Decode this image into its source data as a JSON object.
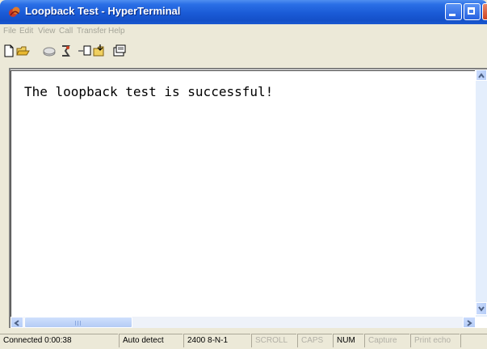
{
  "window": {
    "title": "Loopback Test - HyperTerminal"
  },
  "menu": [
    {
      "label": "File"
    },
    {
      "label": "Edit"
    },
    {
      "label": "View"
    },
    {
      "label": "Call"
    },
    {
      "label": "Transfer"
    },
    {
      "label": "Help"
    }
  ],
  "toolbar": {
    "icons": [
      "new-icon",
      "open-icon",
      "connect-icon",
      "disconnect-icon",
      "send-icon",
      "receive-icon",
      "properties-icon"
    ]
  },
  "terminal": {
    "text": "The loopback test is successful!"
  },
  "status": {
    "connected": "Connected 0:00:38",
    "detect": "Auto detect",
    "settings": "2400 8-N-1",
    "scroll": "SCROLL",
    "caps": "CAPS",
    "num": "NUM",
    "capture": "Capture",
    "print_echo": "Print echo"
  },
  "colors": {
    "title_bar": "#1a5ad6",
    "disabled_text": "#a5a599"
  }
}
